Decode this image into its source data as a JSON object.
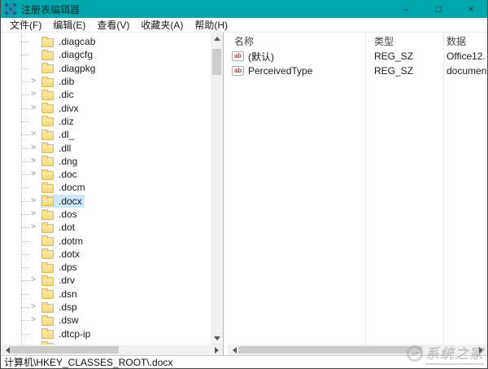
{
  "window": {
    "title": "注册表编辑器",
    "controls": {
      "minimize": "–",
      "maximize": "□",
      "close": "×"
    }
  },
  "menu": {
    "items": [
      "文件(F)",
      "编辑(E)",
      "查看(V)",
      "收藏夹(A)",
      "帮助(H)"
    ]
  },
  "tree": {
    "items": [
      {
        "label": ".diagcab",
        "expandable": false,
        "selected": false
      },
      {
        "label": ".diagcfg",
        "expandable": false,
        "selected": false
      },
      {
        "label": ".diagpkg",
        "expandable": false,
        "selected": false
      },
      {
        "label": ".dib",
        "expandable": true,
        "selected": false
      },
      {
        "label": ".dic",
        "expandable": true,
        "selected": false
      },
      {
        "label": ".divx",
        "expandable": true,
        "selected": false
      },
      {
        "label": ".diz",
        "expandable": false,
        "selected": false
      },
      {
        "label": ".dl_",
        "expandable": true,
        "selected": false
      },
      {
        "label": ".dll",
        "expandable": true,
        "selected": false
      },
      {
        "label": ".dng",
        "expandable": true,
        "selected": false
      },
      {
        "label": ".doc",
        "expandable": true,
        "selected": false
      },
      {
        "label": ".docm",
        "expandable": false,
        "selected": false
      },
      {
        "label": ".docx",
        "expandable": true,
        "selected": true
      },
      {
        "label": ".dos",
        "expandable": true,
        "selected": false
      },
      {
        "label": ".dot",
        "expandable": true,
        "selected": false
      },
      {
        "label": ".dotm",
        "expandable": false,
        "selected": false
      },
      {
        "label": ".dotx",
        "expandable": false,
        "selected": false
      },
      {
        "label": ".dps",
        "expandable": false,
        "selected": false
      },
      {
        "label": ".drv",
        "expandable": true,
        "selected": false
      },
      {
        "label": ".dsn",
        "expandable": false,
        "selected": false
      },
      {
        "label": ".dsp",
        "expandable": true,
        "selected": false
      },
      {
        "label": ".dsw",
        "expandable": true,
        "selected": false
      },
      {
        "label": ".dtcp-ip",
        "expandable": false,
        "selected": false
      },
      {
        "label": "",
        "expandable": false,
        "selected": false,
        "partial": true
      }
    ]
  },
  "list": {
    "columns": {
      "name": "名称",
      "type": "类型",
      "data": "数据"
    },
    "rows": [
      {
        "icon": "reg-sz-ab",
        "name": "(默认)",
        "type": "REG_SZ",
        "data": "Office12."
      },
      {
        "icon": "reg-sz-ab",
        "name": "PerceivedType",
        "type": "REG_SZ",
        "data": "documen"
      }
    ]
  },
  "statusbar": {
    "path": "计算机\\HKEY_CLASSES_ROOT\\.docx"
  },
  "watermark": {
    "text": "系统之家"
  },
  "colors": {
    "titlebar": "#00a7ad",
    "selection": "#cce8ff",
    "folder": "#f5d877"
  },
  "icons": {
    "app": "registry-grid-icon",
    "value": "ab-string-icon"
  }
}
